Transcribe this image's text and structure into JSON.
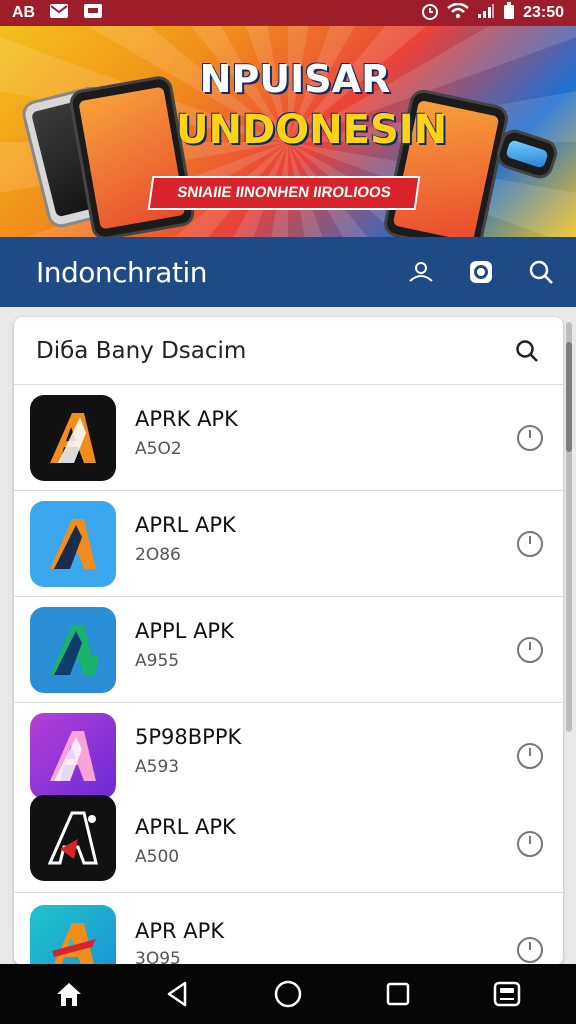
{
  "status_bar": {
    "left_text": "AB",
    "time": "23:50"
  },
  "banner": {
    "title_line1": "NPUISAR",
    "title_line2": "UNDONESIN",
    "ribbon_text": "SNIAIIE IINONHEN IIROLIOOS"
  },
  "app_bar": {
    "title": "Indonchratin"
  },
  "search": {
    "text": "Diба Bany Dsacim"
  },
  "apps": [
    {
      "name": "APRK APK",
      "code": "A5O2",
      "accent": "#111111"
    },
    {
      "name": "APRL APK",
      "code": "2O86",
      "accent": "#3aa7ee"
    },
    {
      "name": "APPL APK",
      "code": "A955",
      "accent": "#2b8fd8"
    },
    {
      "name": "5P98BPPK",
      "code": "A593",
      "accent": "#8a3ad6"
    },
    {
      "name": "APRL APK",
      "code": "A500",
      "accent": "#111111"
    },
    {
      "name": "APR APK",
      "code": "3O95",
      "accent": "#20c3c8"
    }
  ],
  "colors": {
    "status_bar": "#9e1d2a",
    "app_bar": "#1e4a86",
    "nav_bar": "#060606"
  },
  "icons": {
    "status_left": [
      "gmail-icon",
      "message-icon"
    ],
    "status_right": [
      "alarm-icon",
      "wifi-icon",
      "signal-icon",
      "battery-icon"
    ],
    "app_bar": [
      "user-icon",
      "camera-icon",
      "search-icon"
    ],
    "nav": [
      "home-icon",
      "back-icon",
      "home-circle-icon",
      "recents-icon",
      "assistant-icon"
    ]
  }
}
